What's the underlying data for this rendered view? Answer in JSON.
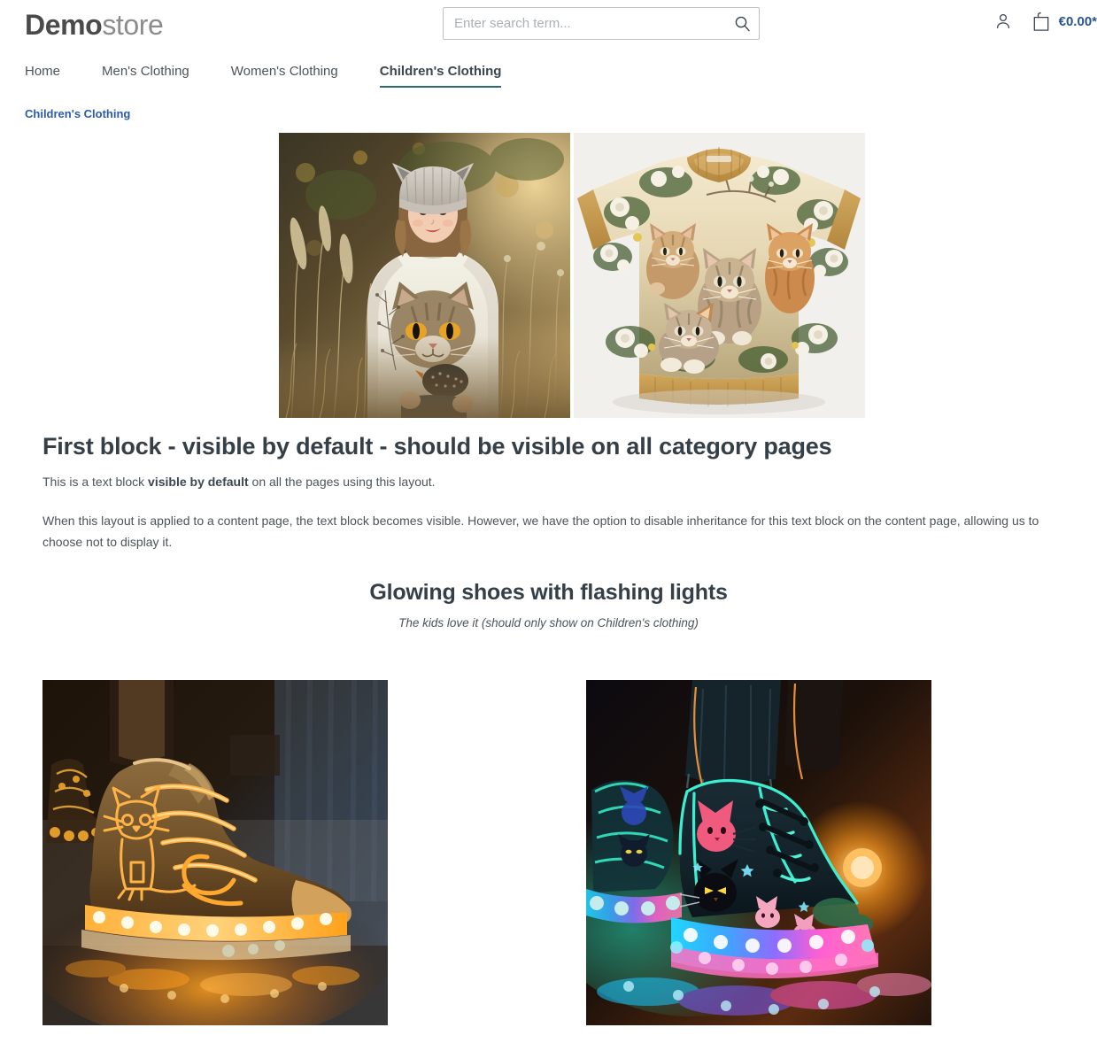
{
  "header": {
    "logo_bold": "Demo",
    "logo_light": "store",
    "search": {
      "placeholder": "Enter search term...",
      "value": "",
      "icon": "search-icon"
    },
    "account_icon": "user-account-icon",
    "cart_icon": "shopping-bag-icon",
    "cart_amount": "€0.00*",
    "accent_color": "#27548f"
  },
  "nav": {
    "items": [
      {
        "label": "Home",
        "active": false
      },
      {
        "label": "Men's Clothing",
        "active": false
      },
      {
        "label": "Women's Clothing",
        "active": false
      },
      {
        "label": "Children's Clothing",
        "active": true
      }
    ],
    "active_underline_color": "#2d6a72"
  },
  "breadcrumb": {
    "label": "Children's Clothing",
    "color": "#2a5ca8"
  },
  "hero": {
    "images": [
      {
        "name": "girl-wearing-cat-sweater-photo",
        "alt": "Smiling girl in grey cat-ear beanie wearing a cream sweater with a tabby cat print, standing in golden autumn grass"
      },
      {
        "name": "kitten-floral-sweatshirt-photo",
        "alt": "Children's sweatshirt with tan ribbed trim printed with four kittens among white roses and foliage"
      }
    ]
  },
  "content_block": {
    "title": "First block - visible by default - should be visible on all category pages",
    "lead_before": "This is a text block ",
    "lead_bold": "visible by default",
    "lead_after": " on all the pages using this layout.",
    "paragraph": "When this layout is applied to a content page, the text block becomes visible. However, we have the option to disable inheritance for this text block on the content page, allowing us to choose not to display it."
  },
  "shoes_section": {
    "title": "Glowing shoes with flashing lights",
    "subtitle": "The kids love it (should only show on Children's clothing)",
    "images": [
      {
        "name": "orange-glowing-cat-sneaker-photo",
        "alt": "White high-top sneaker with orange glowing cat outline and amber LED lights along the sole"
      },
      {
        "name": "rainbow-glowing-cat-boot-photo",
        "alt": "Dark high-top boot with neon cat graphics and multicolour blue, pink and green LED lights in the platform sole"
      }
    ]
  }
}
